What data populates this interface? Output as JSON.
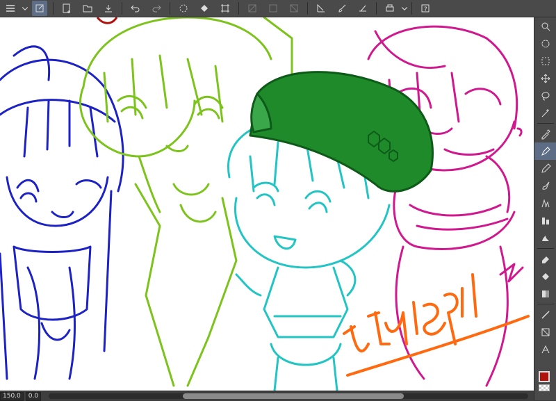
{
  "status": {
    "zoom": "150.0",
    "angle": "0.0",
    "horizontal_scroll_position": 0.51
  },
  "canvas": {
    "signature_text": "ptuisgal",
    "colors": {
      "blue_character": "#1c22c4",
      "green_character": "#7cc41c",
      "cyan_character": "#22c4c4",
      "magenta_character": "#d0198f",
      "beret_fill": "#1e8a2a",
      "signature": "#ff6a10",
      "red_mark": "#b0120e"
    }
  },
  "toolbar": {
    "icons": [
      "menu-icon",
      "chevron-down-icon",
      "layer-icon",
      "new-canvas-icon",
      "open-folder-icon",
      "save-icon",
      "undo-icon",
      "redo-icon",
      "loading-icon",
      "fill-icon",
      "transform-icon",
      "disabled-icon",
      "disabled-icon",
      "disabled-icon",
      "ruler-icon",
      "brush-icon",
      "stabilizer-icon",
      "print-icon",
      "chevron-down-icon",
      "help-icon"
    ]
  },
  "tools": {
    "items": [
      "zoom-tool-icon",
      "rotate-tool-icon",
      "selection-tool-icon",
      "move-tool-icon",
      "lasso-tool-icon",
      "magic-wand-icon",
      "eyedropper-icon",
      "pen-tool-icon",
      "pencil-tool-icon",
      "brush-tool-icon",
      "airbrush-tool-icon",
      "decoration-tool-icon",
      "blend-tool-icon",
      "eraser-tool-icon",
      "fill-bucket-icon",
      "gradient-tool-icon",
      "line-tool-icon",
      "figure-tool-icon",
      "text-tool-icon"
    ],
    "active_index": 7,
    "main_color": "#b0120e"
  }
}
